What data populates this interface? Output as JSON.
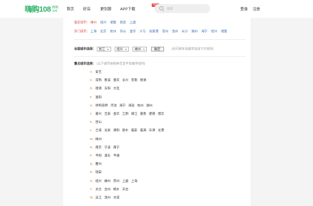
{
  "header": {
    "logo_main": "嗨购108",
    "logo_sub_top": "购物",
    "logo_sub_bottom": "108",
    "nav": [
      "首页",
      "好店",
      "更划算",
      "APP下载"
    ],
    "hot_badge": "NEW",
    "search_placeholder": "搜索",
    "login": "登录",
    "register": "注册"
  },
  "nearby": {
    "label": "临近城市：",
    "cities": [
      "嵊州",
      "绍兴",
      "诸暨",
      "新昌",
      "上虞"
    ]
  },
  "hot": {
    "label": "热门城市：",
    "cities": [
      "上海",
      "北京",
      "杭州",
      "舟山",
      "金华",
      "义乌",
      "张家港",
      "常州",
      "温州",
      "长沙",
      "湖州",
      "海宁",
      "绍兴",
      "诸暨"
    ]
  },
  "province_select": {
    "label": "全国城市选择：",
    "province": "浙江",
    "city": "绍兴",
    "county": "嵊州",
    "confirm": "确定",
    "hint": "(也可按字母顺序选择下方城市)"
  },
  "letter_section": {
    "label": "重点城市选择：",
    "hint": "(以下城市按照拼音首字母顺序排列)",
    "rows": [
      {
        "letter": "A.",
        "cities": [
          "安吉"
        ]
      },
      {
        "letter": "C.",
        "cities": [
          "常熟",
          "慈溪",
          "重庆",
          "长兴",
          "苍南",
          "德清"
        ]
      },
      {
        "letter": "D.",
        "cities": [
          "德清",
          "东阳",
          "大连"
        ]
      },
      {
        "letter": "F.",
        "cities": [
          "富阳"
        ]
      },
      {
        "letter": "H.",
        "cities": [
          "呼和浩特",
          "河池",
          "海宁",
          "海盐",
          "杭州",
          "湖州"
        ]
      },
      {
        "letter": "J.",
        "cities": [
          "嘉兴",
          "吉安",
          "金华",
          "江阴",
          "靖江",
          "嘉善",
          "建德",
          "缙云"
        ]
      },
      {
        "letter": "K.",
        "cities": [
          "昆山"
        ]
      },
      {
        "letter": "L.",
        "cities": [
          "兰溪",
          "龙泉",
          "溧阳",
          "丽水",
          "临安",
          "临海",
          "乐清",
          "龙港"
        ]
      },
      {
        "letter": "M.",
        "cities": [
          "梅州"
        ]
      },
      {
        "letter": "N.",
        "cities": [
          "南京",
          "宁波",
          "南宁"
        ]
      },
      {
        "letter": "P.",
        "cities": [
          "平阳",
          "浦东",
          "平湖"
        ]
      },
      {
        "letter": "Q.",
        "cities": [
          "衢州"
        ]
      },
      {
        "letter": "R.",
        "cities": [
          "瑞安"
        ]
      },
      {
        "letter": "S.",
        "cities": [
          "绍兴",
          "嵊州",
          "苏州",
          "上虞",
          "上海"
        ]
      },
      {
        "letter": "T.",
        "cities": [
          "太仓",
          "台州",
          "桐乡",
          "天台"
        ]
      },
      {
        "letter": "W.",
        "cities": [
          "吴江",
          "温州",
          "文成"
        ]
      }
    ]
  },
  "colors": {
    "brand": "#2fb36a",
    "link": "#3b6fb6",
    "red": "#d9534f",
    "letter": "#e0782b"
  }
}
